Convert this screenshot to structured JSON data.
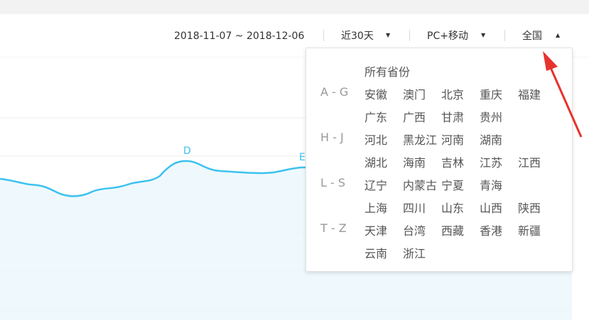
{
  "toolbar": {
    "date_range": "2018-11-07 ~ 2018-12-06",
    "period": "近30天",
    "device": "PC+移动",
    "region": "全国",
    "caret_down": "▼",
    "caret_up": "▲"
  },
  "chart_data": {
    "type": "area",
    "annotations": [
      "D",
      "E"
    ],
    "series_color": "#3cc2ef"
  },
  "region_dropdown": {
    "all_label": "所有省份",
    "groups": [
      {
        "label": "A - G",
        "rows": [
          [
            "安徽",
            "澳门",
            "北京",
            "重庆",
            "福建"
          ],
          [
            "广东",
            "广西",
            "甘肃",
            "贵州"
          ]
        ]
      },
      {
        "label": "H - J",
        "rows": [
          [
            "河北",
            "黑龙江",
            "河南",
            "湖南"
          ],
          [
            "湖北",
            "海南",
            "吉林",
            "江苏",
            "江西"
          ]
        ]
      },
      {
        "label": "L - S",
        "rows": [
          [
            "辽宁",
            "内蒙古",
            "宁夏",
            "青海"
          ],
          [
            "上海",
            "四川",
            "山东",
            "山西",
            "陕西"
          ]
        ]
      },
      {
        "label": "T - Z",
        "rows": [
          [
            "天津",
            "台湾",
            "西藏",
            "香港",
            "新疆"
          ],
          [
            "云南",
            "浙江"
          ]
        ]
      }
    ]
  },
  "colors": {
    "accent": "#3cc2ef",
    "arrow": "#e8322e"
  }
}
